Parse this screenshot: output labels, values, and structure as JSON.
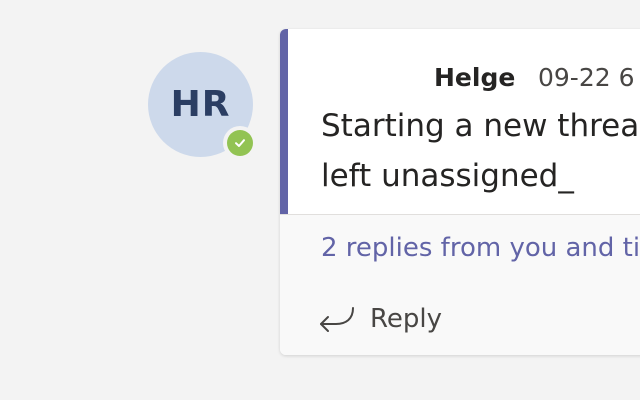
{
  "avatar": {
    "initials": "HR",
    "presence": "available"
  },
  "message": {
    "author": "Helge",
    "timestamp": "09-22 6",
    "text_line1": "Starting a new thread",
    "text_line2": "left unassigned_"
  },
  "replies": {
    "summary": "2 replies from you and ti"
  },
  "actions": {
    "reply_label": "Reply"
  },
  "colors": {
    "accent": "#6264a7",
    "presence_available": "#92c353",
    "avatar_bg": "#cdd9eb"
  },
  "icons": {
    "presence": "check-icon",
    "reply": "reply-arrow-icon"
  }
}
